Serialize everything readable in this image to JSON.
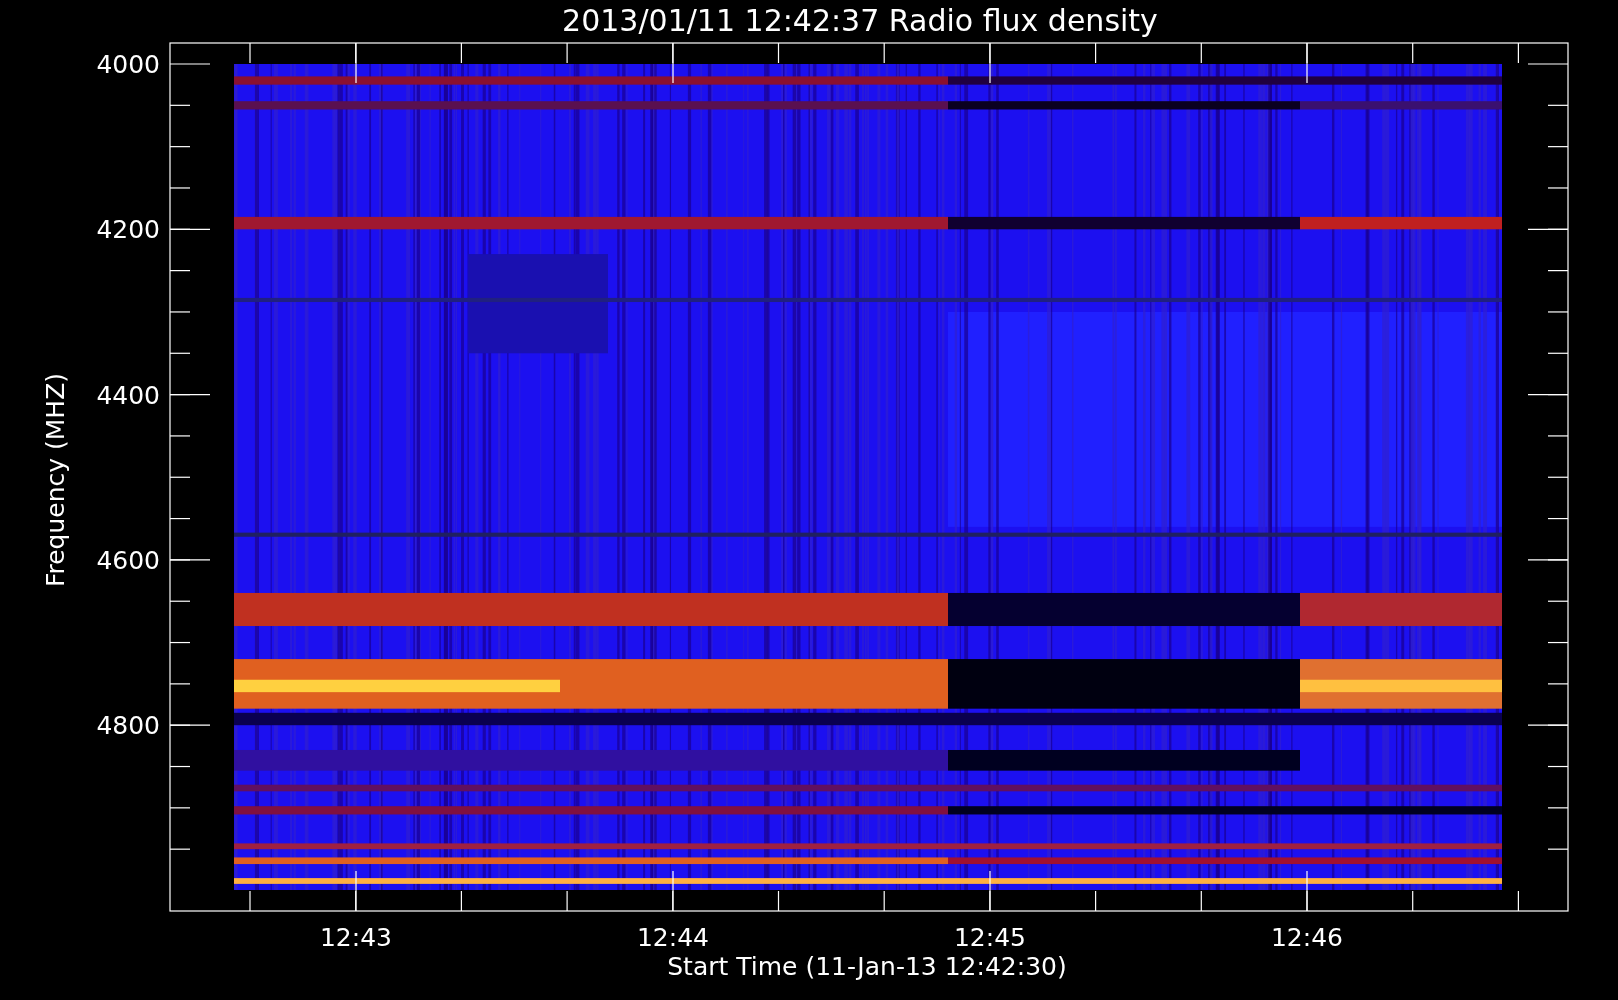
{
  "title": "2013/01/11 12:42:37 Radio flux density",
  "y_axis": {
    "label": "Frequency (MHZ)",
    "ticks": [
      "4000",
      "4200",
      "4400",
      "4600",
      "4800"
    ]
  },
  "x_axis": {
    "label": "Start Time (11-Jan-13 12:42:30)",
    "ticks": [
      "12:43",
      "12:44",
      "12:45",
      "12:46"
    ]
  }
}
